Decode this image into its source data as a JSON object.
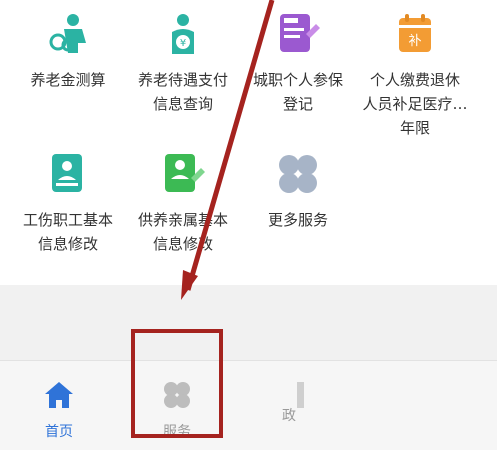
{
  "services": [
    {
      "label": "养老金测算",
      "icon": "pension-calc-person-icon",
      "color": "#2bb3a3"
    },
    {
      "label": "养老待遇支付信息查询",
      "icon": "pension-payment-query-icon",
      "color": "#2bb3a3"
    },
    {
      "label": "城职个人参保登记",
      "icon": "insurance-register-form-icon",
      "color": "#9b59d0"
    },
    {
      "label": "个人缴费退休人员补足医疗…年限",
      "icon": "calendar-supplement-icon",
      "color": "#f39c34"
    },
    {
      "label": "工伤职工基本信息修改",
      "icon": "work-injury-edit-icon",
      "color": "#2bb3a3"
    },
    {
      "label": "供养亲属基本信息修改",
      "icon": "dependent-info-edit-icon",
      "color": "#3cba54"
    },
    {
      "label": "更多服务",
      "icon": "more-services-grid-icon",
      "color": "#a7b4c7"
    }
  ],
  "tiles_text": {
    "t0": [
      "养老金测算"
    ],
    "t1": [
      "养老待遇支付",
      "信息查询"
    ],
    "t2": [
      "城职个人参保",
      "登记"
    ],
    "t3": [
      "个人缴费退休",
      "人员补足医疗…",
      "年限"
    ],
    "t4": [
      "工伤职工基本",
      "信息修改"
    ],
    "t5": [
      "供养亲属基本",
      "信息修改"
    ],
    "t6": [
      "更多服务"
    ]
  },
  "calendar_badge": "补",
  "tabbar": {
    "home": {
      "label": "首页",
      "icon": "home-icon",
      "color": "#2f73d8"
    },
    "service": {
      "label": "服务",
      "icon": "service-grid-icon",
      "color": "#9a9a9a"
    },
    "partial_label": "政"
  },
  "annotation": {
    "color": "#a5231f"
  }
}
